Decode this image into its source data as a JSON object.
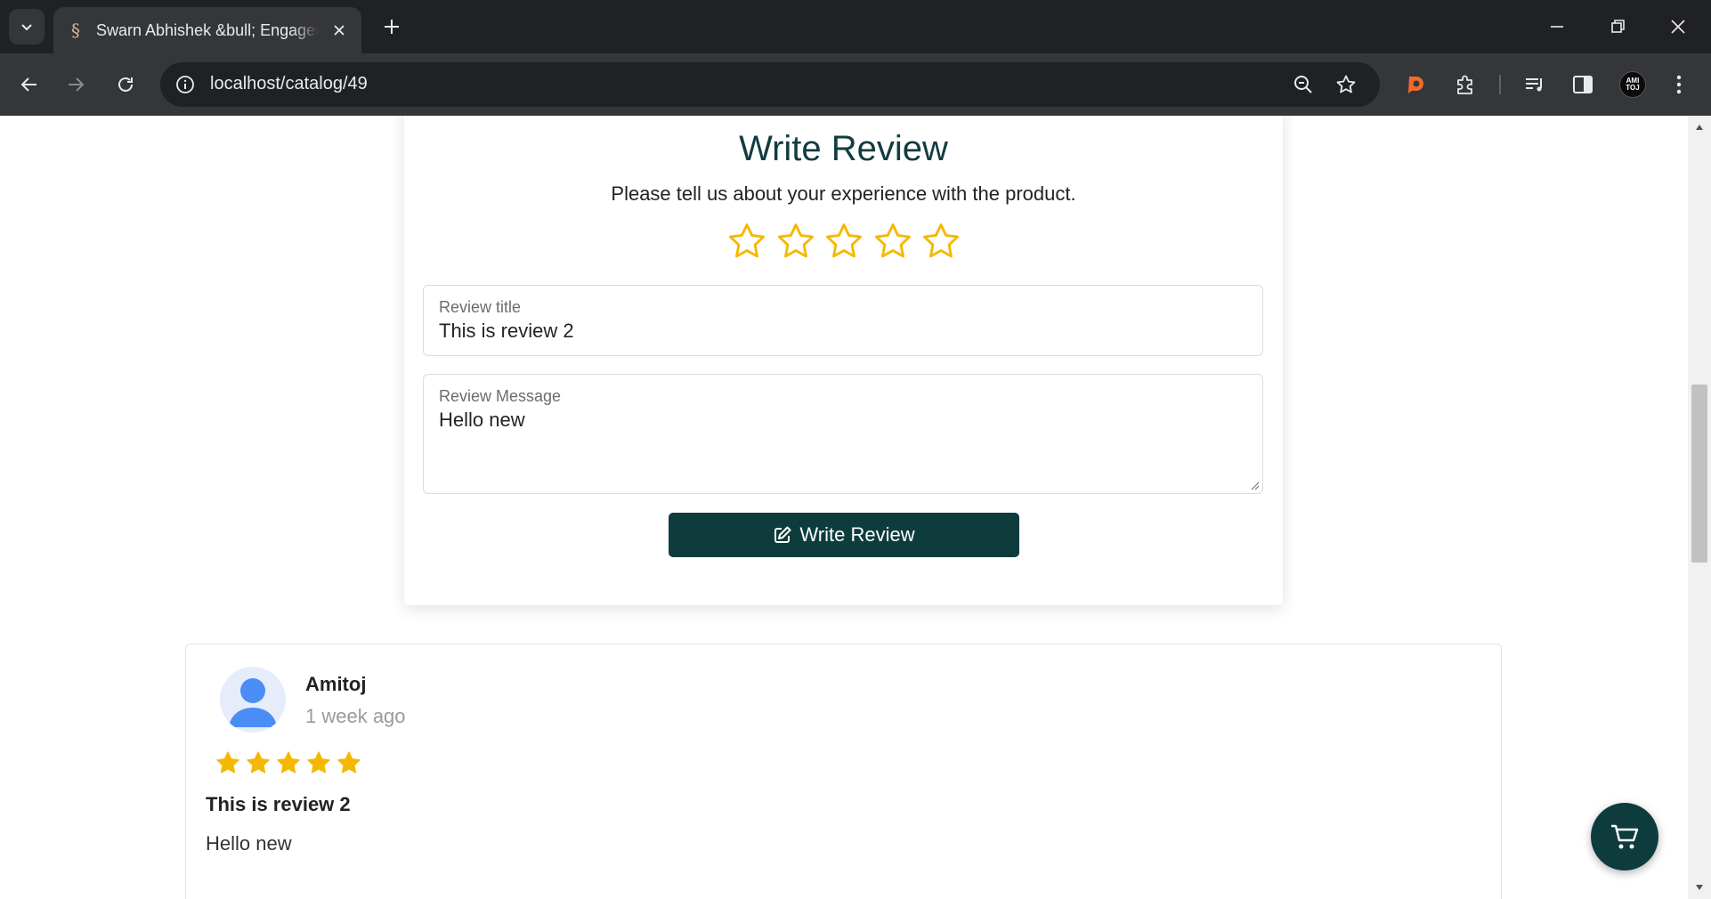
{
  "browser": {
    "tab_title": "Swarn Abhishek &bull; Engagement",
    "url": "localhost/catalog/49",
    "profile_initials": "AMI\nTOJ",
    "colors": {
      "frame": "#202124",
      "toolbar": "#35363a",
      "brave_accent": "#f26b2a"
    }
  },
  "write_review": {
    "heading": "Write Review",
    "subtitle": "Please tell us about your experience with the product.",
    "selected_rating": 0,
    "max_rating": 5,
    "title_field": {
      "label": "Review title",
      "value": "This is review 2"
    },
    "message_field": {
      "label": "Review Message",
      "value": "Hello new"
    },
    "submit_label": "Write Review",
    "colors": {
      "heading": "#123c40",
      "star": "#f5b800",
      "button": "#0e3c3d"
    }
  },
  "reviews": [
    {
      "author": "Amitoj",
      "time_ago": "1 week ago",
      "rating": 5,
      "title": "This is review 2",
      "message": "Hello new"
    }
  ],
  "cart_fab": {
    "icon": "cart-icon"
  }
}
